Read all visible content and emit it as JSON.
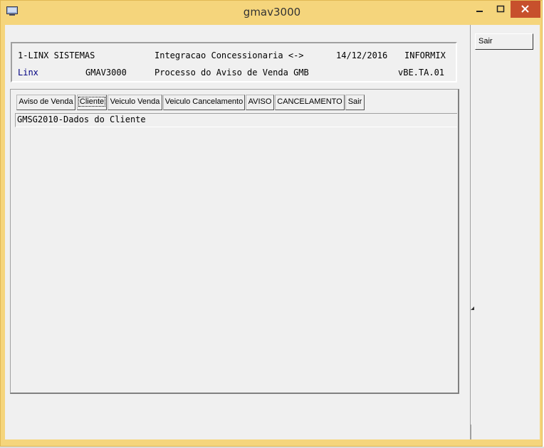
{
  "window": {
    "title": "gmav3000",
    "min_symbol": "–",
    "max_symbol": "☐",
    "close_symbol": "✕"
  },
  "header": {
    "row1": {
      "company": "1-LINX SISTEMAS",
      "system": "Integracao Concessionaria <->",
      "date": "14/12/2016",
      "db": "INFORMIX"
    },
    "row2": {
      "brand": "Linx",
      "program": "GMAV3000",
      "description": "Processo do Aviso de Venda GMB",
      "version": "vBE.TA.01"
    }
  },
  "tabs": [
    {
      "label": "Aviso de Venda"
    },
    {
      "label": "Cliente",
      "active": true
    },
    {
      "label": "Veiculo Venda"
    },
    {
      "label": "Veiculo Cancelamento"
    },
    {
      "label": "AVISO"
    },
    {
      "label": "CANCELAMENTO"
    },
    {
      "label": "Sair"
    }
  ],
  "panel": {
    "subtitle": "GMSG2010-Dados do Cliente"
  },
  "sidebar": {
    "sair_label": "Sair"
  },
  "colors": {
    "titlebar": "#f5d57c",
    "close": "#c7502c",
    "client": "#f0f0f0",
    "brand_blue": "#000080"
  }
}
